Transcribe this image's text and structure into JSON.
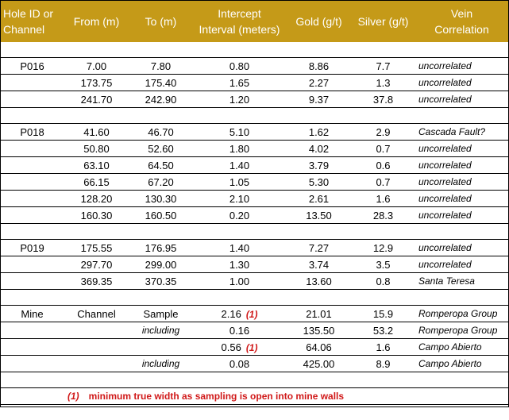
{
  "headers": {
    "hole_id": [
      "Hole ID or",
      "Channel"
    ],
    "from": "From (m)",
    "to": "To (m)",
    "intercept": [
      "Intercept",
      "Interval (meters)"
    ],
    "gold": "Gold (g/t)",
    "silver": "Silver (g/t)",
    "vein": [
      "Vein",
      "Correlation"
    ]
  },
  "groups": [
    {
      "rows": [
        {
          "hole": "P016",
          "from": "7.00",
          "to": "7.80",
          "interval": "0.80",
          "gold": "8.86",
          "silver": "7.7",
          "vein": "uncorrelated"
        },
        {
          "hole": "",
          "from": "173.75",
          "to": "175.40",
          "interval": "1.65",
          "gold": "2.27",
          "silver": "1.3",
          "vein": "uncorrelated"
        },
        {
          "hole": "",
          "from": "241.70",
          "to": "242.90",
          "interval": "1.20",
          "gold": "9.37",
          "silver": "37.8",
          "vein": "uncorrelated"
        }
      ]
    },
    {
      "rows": [
        {
          "hole": "P018",
          "from": "41.60",
          "to": "46.70",
          "interval": "5.10",
          "gold": "1.62",
          "silver": "2.9",
          "vein": "Cascada Fault?"
        },
        {
          "hole": "",
          "from": "50.80",
          "to": "52.60",
          "interval": "1.80",
          "gold": "4.02",
          "silver": "0.7",
          "vein": "uncorrelated"
        },
        {
          "hole": "",
          "from": "63.10",
          "to": "64.50",
          "interval": "1.40",
          "gold": "3.79",
          "silver": "0.6",
          "vein": "uncorrelated"
        },
        {
          "hole": "",
          "from": "66.15",
          "to": "67.20",
          "interval": "1.05",
          "gold": "5.30",
          "silver": "0.7",
          "vein": "uncorrelated"
        },
        {
          "hole": "",
          "from": "128.20",
          "to": "130.30",
          "interval": "2.10",
          "gold": "2.61",
          "silver": "1.6",
          "vein": "uncorrelated"
        },
        {
          "hole": "",
          "from": "160.30",
          "to": "160.50",
          "interval": "0.20",
          "gold": "13.50",
          "silver": "28.3",
          "vein": "uncorrelated"
        }
      ]
    },
    {
      "rows": [
        {
          "hole": "P019",
          "from": "175.55",
          "to": "176.95",
          "interval": "1.40",
          "gold": "7.27",
          "silver": "12.9",
          "vein": "uncorrelated"
        },
        {
          "hole": "",
          "from": "297.70",
          "to": "299.00",
          "interval": "1.30",
          "gold": "3.74",
          "silver": "3.5",
          "vein": "uncorrelated"
        },
        {
          "hole": "",
          "from": "369.35",
          "to": "370.35",
          "interval": "1.00",
          "gold": "13.60",
          "silver": "0.8",
          "vein": "Santa Teresa"
        }
      ]
    }
  ],
  "mine": {
    "rows": [
      {
        "hole": "Mine",
        "from": "Channel",
        "to": "Sample",
        "interval": "2.16",
        "flag": "(1)",
        "gold": "21.01",
        "silver": "15.9",
        "vein": "Romperopa Group"
      },
      {
        "hole": "",
        "from": "",
        "to": "including",
        "interval": "0.16",
        "flag": "",
        "gold": "135.50",
        "silver": "53.2",
        "vein": "Romperopa Group"
      },
      {
        "hole": "",
        "from": "",
        "to": "",
        "interval": "0.56",
        "flag": "(1)",
        "gold": "64.06",
        "silver": "1.6",
        "vein": "Campo Abierto"
      },
      {
        "hole": "",
        "from": "",
        "to": "including",
        "interval": "0.08",
        "flag": "",
        "gold": "425.00",
        "silver": "8.9",
        "vein": "Campo Abierto"
      }
    ]
  },
  "footnote": {
    "marker": "(1)",
    "text": "minimum  true width as sampling is open into mine walls"
  },
  "colors": {
    "header_bg": "#c59a18",
    "header_text": "#ffffff",
    "footnote": "#d01818"
  }
}
